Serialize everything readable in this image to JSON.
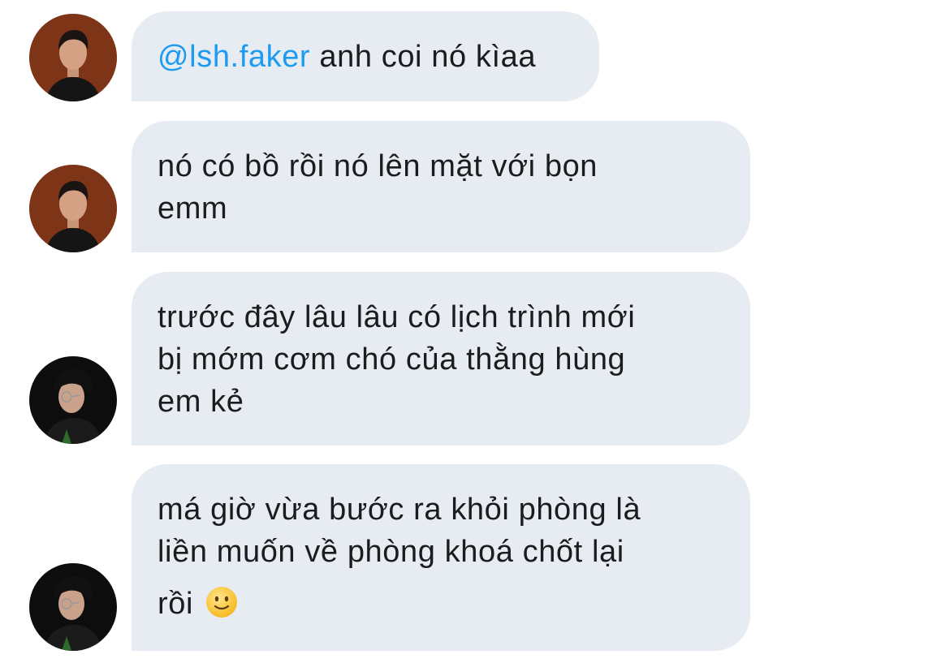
{
  "messages": [
    {
      "sender_avatar": "avatar-red-background",
      "mention": "@lsh.faker",
      "text": " anh coi nó kìaa",
      "lines": []
    },
    {
      "sender_avatar": "avatar-red-background",
      "lines": [
        "nó có bồ rồi nó lên mặt với bọn",
        "emm"
      ]
    },
    {
      "sender_avatar": "avatar-glasses-dark",
      "lines": [
        "trước đây lâu lâu có lịch trình mới",
        "bị mớm cơm chó của thằng hùng",
        "em kẻ"
      ]
    },
    {
      "sender_avatar": "avatar-glasses-dark",
      "lines": [
        "má giờ vừa bước ra khỏi phòng là",
        "liền muốn về phòng khoá chốt lại",
        "rồi"
      ],
      "emoji": "slightly-smiling-face-icon"
    }
  ],
  "colors": {
    "bubble": "#e7ecf2",
    "mention": "#1d9bf0",
    "text": "#1c1c1e"
  }
}
